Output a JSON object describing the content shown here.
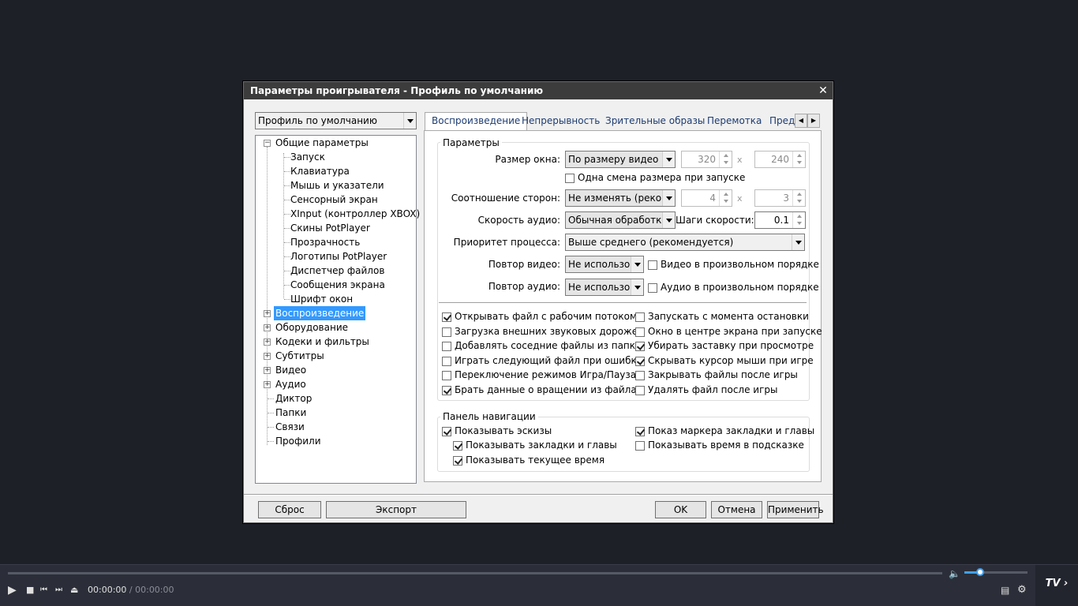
{
  "dialog": {
    "title": "Параметры проигрывателя - Профиль по умолчанию",
    "close": "✕",
    "profile_select": "Профиль по умолчанию"
  },
  "tree": {
    "general": "Общие параметры",
    "general_children": [
      "Запуск",
      "Клавиатура",
      "Мышь и указатели",
      "Сенсорный экран",
      "XInput (контроллер XBOX)",
      "Скины PotPlayer",
      "Прозрачность",
      "Логотипы PotPlayer",
      "Диспетчер файлов",
      "Сообщения экрана",
      "Шрифт окон"
    ],
    "expandable": [
      "Воспроизведение",
      "Оборудование",
      "Кодеки и фильтры",
      "Субтитры",
      "Видео",
      "Аудио"
    ],
    "plain": [
      "Диктор",
      "Папки",
      "Связи",
      "Профили"
    ],
    "selected": "Воспроизведение"
  },
  "tabs": [
    "Воспроизведение",
    "Непрерывность",
    "Зрительные образы",
    "Перемотка",
    "Пред"
  ],
  "params": {
    "group_title": "Параметры",
    "window_size_label": "Размер окна:",
    "window_size_value": "По размеру видео",
    "width": "320",
    "height": "240",
    "times": "x",
    "resize_once": "Одна смена размера при запуске",
    "aspect_label": "Соотношение сторон:",
    "aspect_value": "Не изменять (рекоме",
    "aspect_w": "4",
    "aspect_h": "3",
    "audio_speed_label": "Скорость аудио:",
    "audio_speed_value": "Обычная обработка",
    "speed_step_label": "Шаги скорости:",
    "speed_step_value": "0.1",
    "priority_label": "Приоритет процесса:",
    "priority_value": "Выше среднего (рекомендуется)",
    "repeat_video_label": "Повтор видео:",
    "repeat_video_value": "Не использов",
    "video_shuffle": "Видео в произвольном порядке",
    "repeat_audio_label": "Повтор аудио:",
    "repeat_audio_value": "Не использов",
    "audio_shuffle": "Аудио в произвольном порядке"
  },
  "options_left": [
    {
      "label": "Открывать файл с рабочим потоком",
      "checked": true
    },
    {
      "label": "Загрузка внешних звуковых дорожек",
      "checked": false
    },
    {
      "label": "Добавлять соседние файлы из папки",
      "checked": false
    },
    {
      "label": "Играть следующий файл при ошибке",
      "checked": false
    },
    {
      "label": "Переключение режимов Игра/Пауза",
      "checked": false
    },
    {
      "label": "Брать данные о вращении из файла",
      "checked": true
    }
  ],
  "options_right": [
    {
      "label": "Запускать с момента остановки",
      "checked": false
    },
    {
      "label": "Окно в центре экрана при запуске",
      "checked": false
    },
    {
      "label": "Убирать заставку при просмотре",
      "checked": true
    },
    {
      "label": "Скрывать курсор мыши при игре",
      "checked": true
    },
    {
      "label": "Закрывать файлы после игры",
      "checked": false
    },
    {
      "label": "Удалять файл после игры",
      "checked": false
    }
  ],
  "nav": {
    "group_title": "Панель навигации",
    "show_thumbs": {
      "label": "Показывать эскизы",
      "checked": true
    },
    "show_bookmarks": {
      "label": "Показывать закладки и главы",
      "checked": true
    },
    "show_time": {
      "label": "Показывать текущее время",
      "checked": true
    },
    "show_marker": {
      "label": "Показ маркера закладки и главы",
      "checked": true
    },
    "show_tooltip_time": {
      "label": "Показывать время в подсказке",
      "checked": false
    }
  },
  "buttons": {
    "reset": "Сброс",
    "export": "Экспорт",
    "ok": "OK",
    "cancel": "Отмена",
    "apply": "Применить"
  },
  "player": {
    "time_current": "00:00:00",
    "time_sep": " / ",
    "time_total": "00:00:00",
    "tv": "TV",
    "volume": 0.25,
    "accent": "#3fa0f0"
  }
}
